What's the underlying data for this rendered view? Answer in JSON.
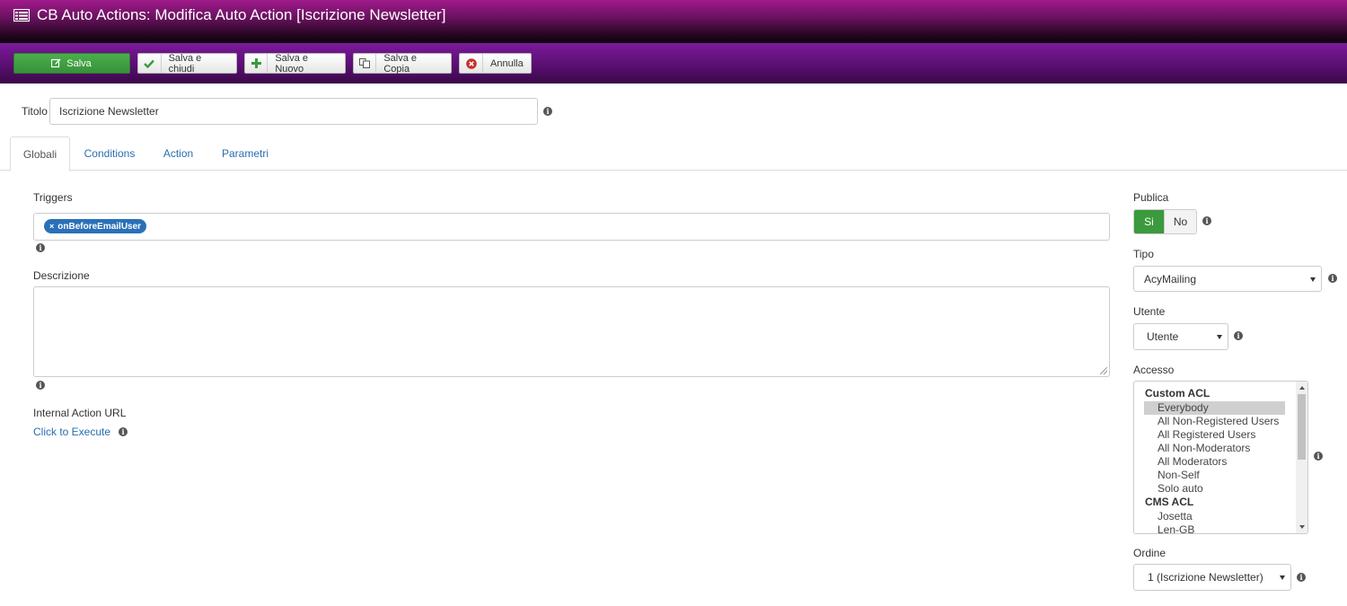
{
  "header": {
    "title": "CB Auto Actions: Modifica Auto Action [Iscrizione Newsletter]"
  },
  "toolbar": {
    "save": "Salva",
    "save_close": "Salva e chiudi",
    "save_new": "Salva e Nuovo",
    "save_copy": "Salva e Copia",
    "cancel": "Annulla"
  },
  "form": {
    "title_label": "Titolo",
    "title_value": "Iscrizione Newsletter"
  },
  "tabs": [
    "Globali",
    "Conditions",
    "Action",
    "Parametri"
  ],
  "main": {
    "triggers_label": "Triggers",
    "trigger_chip": "onBeforeEmailUser",
    "description_label": "Descrizione",
    "internal_url_label": "Internal Action URL",
    "click_execute": "Click to Execute"
  },
  "sidebar": {
    "publica_label": "Publica",
    "publica_yes": "Si",
    "publica_no": "No",
    "tipo_label": "Tipo",
    "tipo_value": "AcyMailing",
    "utente_label": "Utente",
    "utente_value": "Utente",
    "accesso_label": "Accesso",
    "accesso_items": [
      {
        "label": "Custom ACL",
        "group": true
      },
      {
        "label": "Everybody",
        "selected": true
      },
      {
        "label": "All Non-Registered Users"
      },
      {
        "label": "All Registered Users"
      },
      {
        "label": "All Non-Moderators"
      },
      {
        "label": "All Moderators"
      },
      {
        "label": "Non-Self"
      },
      {
        "label": "Solo auto"
      },
      {
        "label": "CMS ACL",
        "group": true
      },
      {
        "label": "Josetta"
      },
      {
        "label": "Len-GB"
      }
    ],
    "ordine_label": "Ordine",
    "ordine_value": "1 (Iscrizione Newsletter)"
  },
  "colors": {
    "header_top": "#a01a8c",
    "toolbar": "#5a0f72",
    "success": "#3a9a3d",
    "link": "#2a6eb0",
    "chip": "#2a70b8"
  },
  "icons": {
    "title": "list-icon",
    "save": "edit-icon",
    "save_close": "check-icon",
    "save_new": "plus-icon",
    "save_copy": "copy-icon",
    "cancel": "cancel-circle-icon",
    "info": "info-icon"
  }
}
